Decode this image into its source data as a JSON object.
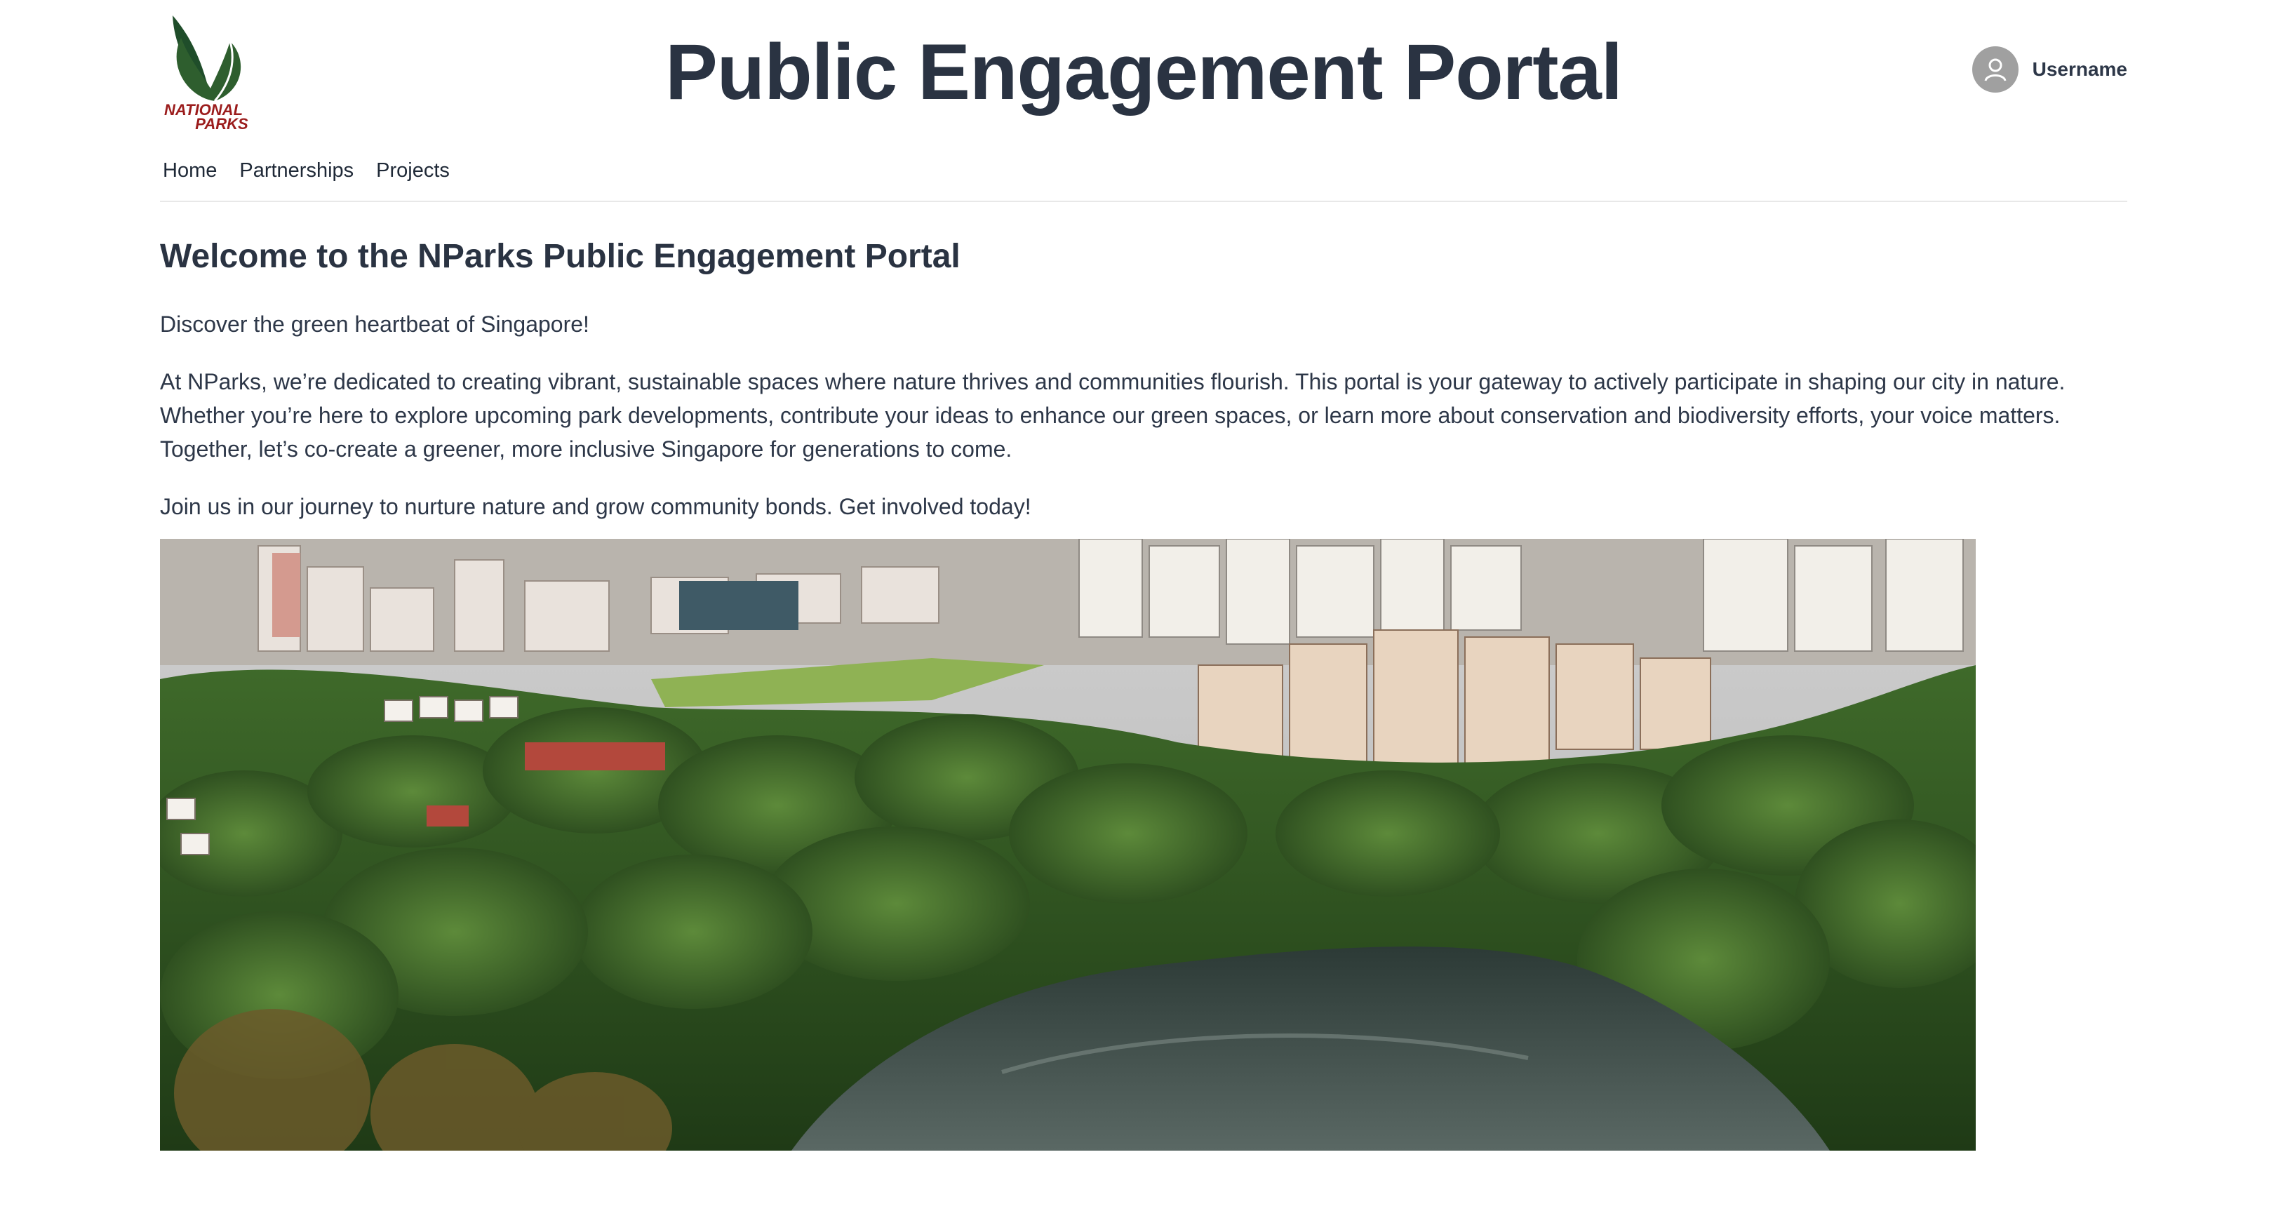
{
  "header": {
    "title": "Public Engagement Portal",
    "logo": {
      "line1": "NATIONAL",
      "line2": "PARKS",
      "icon": "leaf-logo"
    },
    "user": {
      "name": "Username",
      "icon": "user-avatar-icon"
    }
  },
  "nav": {
    "items": [
      {
        "label": "Home"
      },
      {
        "label": "Partnerships"
      },
      {
        "label": "Projects"
      }
    ]
  },
  "main": {
    "heading": "Welcome to the NParks Public Engagement Portal",
    "intro": "Discover the green heartbeat of Singapore!",
    "body": "At NParks, we’re dedicated to creating vibrant, sustainable spaces where nature thrives and communities flourish. This portal is your gateway to actively participate in shaping our city in nature. Whether you’re here to explore upcoming park developments, contribute your ideas to enhance our green spaces, or learn more about conservation and biodiversity efforts, your voice matters. Together, let’s co-create a greener, more inclusive Singapore for generations to come.",
    "cta": "Join us in our journey to nurture nature and grow community bonds. Get involved today!"
  },
  "colors": {
    "title": "#2a3342",
    "text": "#2d3748",
    "logo_green": "#2e5e2e",
    "logo_red": "#9b1c1c",
    "avatar_bg": "#a0a0a0"
  }
}
